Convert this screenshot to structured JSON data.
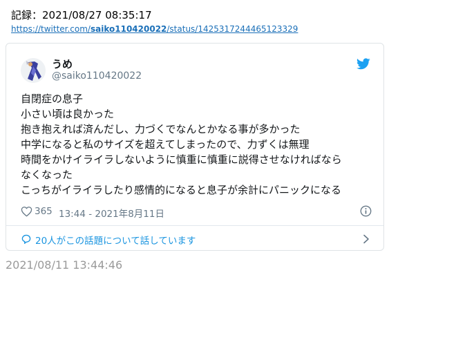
{
  "record": {
    "label": "記録：",
    "datetime": "2021/08/27 08:35:17"
  },
  "source_url": {
    "prefix": "https://twitter.com/",
    "user": "saiko110420022",
    "suffix": "/status/1425317244465123329"
  },
  "tweet": {
    "display_name": "うめ",
    "handle": "@saiko110420022",
    "lines": [
      "自閉症の息子",
      "小さい頃は良かった",
      "抱き抱えれば済んだし、力づくでなんとかなる事が多かった",
      "中学になると私のサイズを超えてしまったので、力ずくは無理",
      "時間をかけイライラしないように慎重に慎重に説得させなければなら",
      "なくなった",
      "こっちがイライラしたり感情的になると息子が余計にパニックになる"
    ],
    "like_count": "365",
    "timestamp": "13:44 - 2021年8月11日",
    "conversation": "20人がこの話題について話しています"
  },
  "footer_date": "2021/08/11 13:44:46",
  "colors": {
    "link": "#1a6fb8",
    "twitter_blue": "#1da1f2",
    "muted_text": "#657786",
    "card_border": "#dfe3e6"
  },
  "icons": {
    "brand": "twitter-bird-icon",
    "like": "heart-icon",
    "info": "info-icon",
    "conversation": "speech-bubble-icon",
    "open": "chevron-right-icon"
  }
}
